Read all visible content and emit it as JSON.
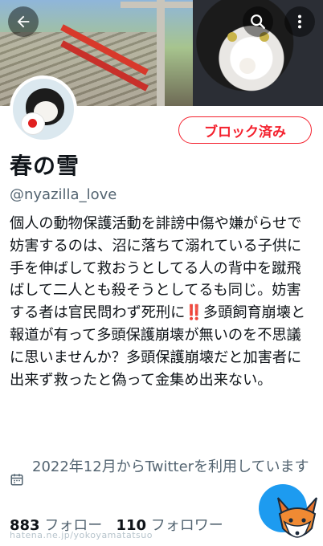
{
  "banner": {
    "back_icon": "arrow-left-icon",
    "search_icon": "search-icon",
    "more_icon": "more-vertical-icon"
  },
  "profile": {
    "name": "春の雪",
    "handle": "@nyazilla_love",
    "blocked_label": "ブロック済み",
    "bio": "個人の動物保護活動を誹謗中傷や嫌がらせで妨害するのは、沼に落ちて溺れている子供に手を伸ばして救おうとしてる人の背中を蹴飛ばして二人とも殺そうとしてるも同じ。妨害する者は官民問わず死刑に‼️多頭飼育崩壊と報道が有って多頭保護崩壊が無いのを不思議に思いませんか？多頭保護崩壊だと加害者に出来ず救ったと偽って金集め出来ない。",
    "joined": "2022年12月からTwitterを利用しています",
    "following_count": "883",
    "following_label": "フォロー",
    "followers_count": "110",
    "followers_label": "フォロワー"
  },
  "watermark": "hatena.ne.jp/yokoyamatatsuo",
  "colors": {
    "accent_red": "#f4212e",
    "twitter_blue": "#1d9bf0",
    "muted_text": "#536471"
  }
}
